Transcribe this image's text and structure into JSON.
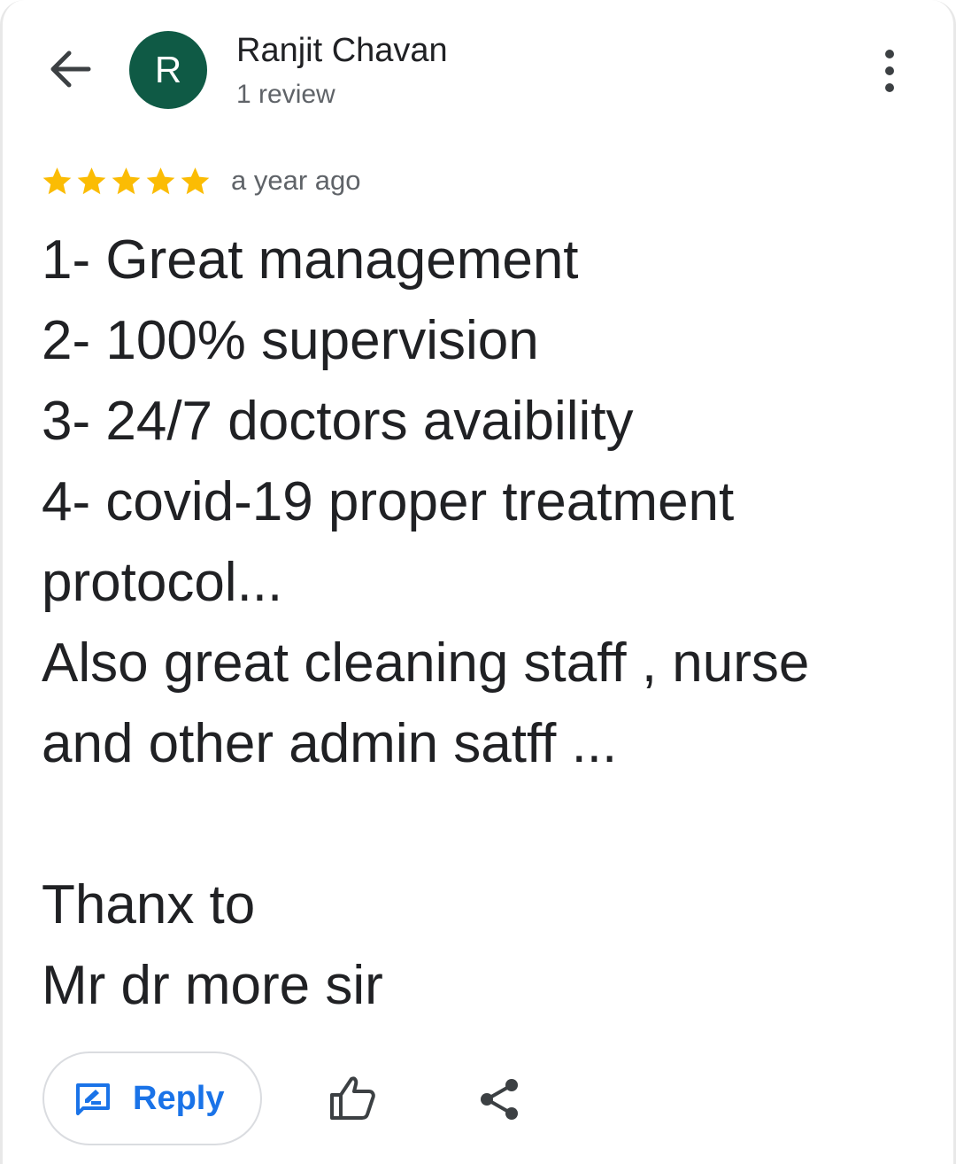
{
  "header": {
    "back_icon": "arrow-back-icon",
    "avatar_initial": "R",
    "avatar_color": "#0f5a45",
    "author_name": "Ranjit Chavan",
    "author_meta": "1 review",
    "more_icon": "more-vert-icon"
  },
  "review": {
    "rating": 5,
    "rating_max": 5,
    "star_color": "#fbbc04",
    "time": "a year ago",
    "lines": [
      "1- Great management",
      "2- 100% supervision",
      "3- 24/7 doctors avaibility",
      "4- covid-19 proper treatment",
      "protocol...",
      "Also great cleaning staff , nurse",
      "and other admin satff ...",
      "",
      "Thanx to",
      "Mr dr more sir"
    ]
  },
  "actions": {
    "reply_label": "Reply",
    "reply_icon": "rate-review-icon",
    "like_icon": "thumb-up-icon",
    "share_icon": "share-icon",
    "accent_color": "#1a73e8"
  }
}
